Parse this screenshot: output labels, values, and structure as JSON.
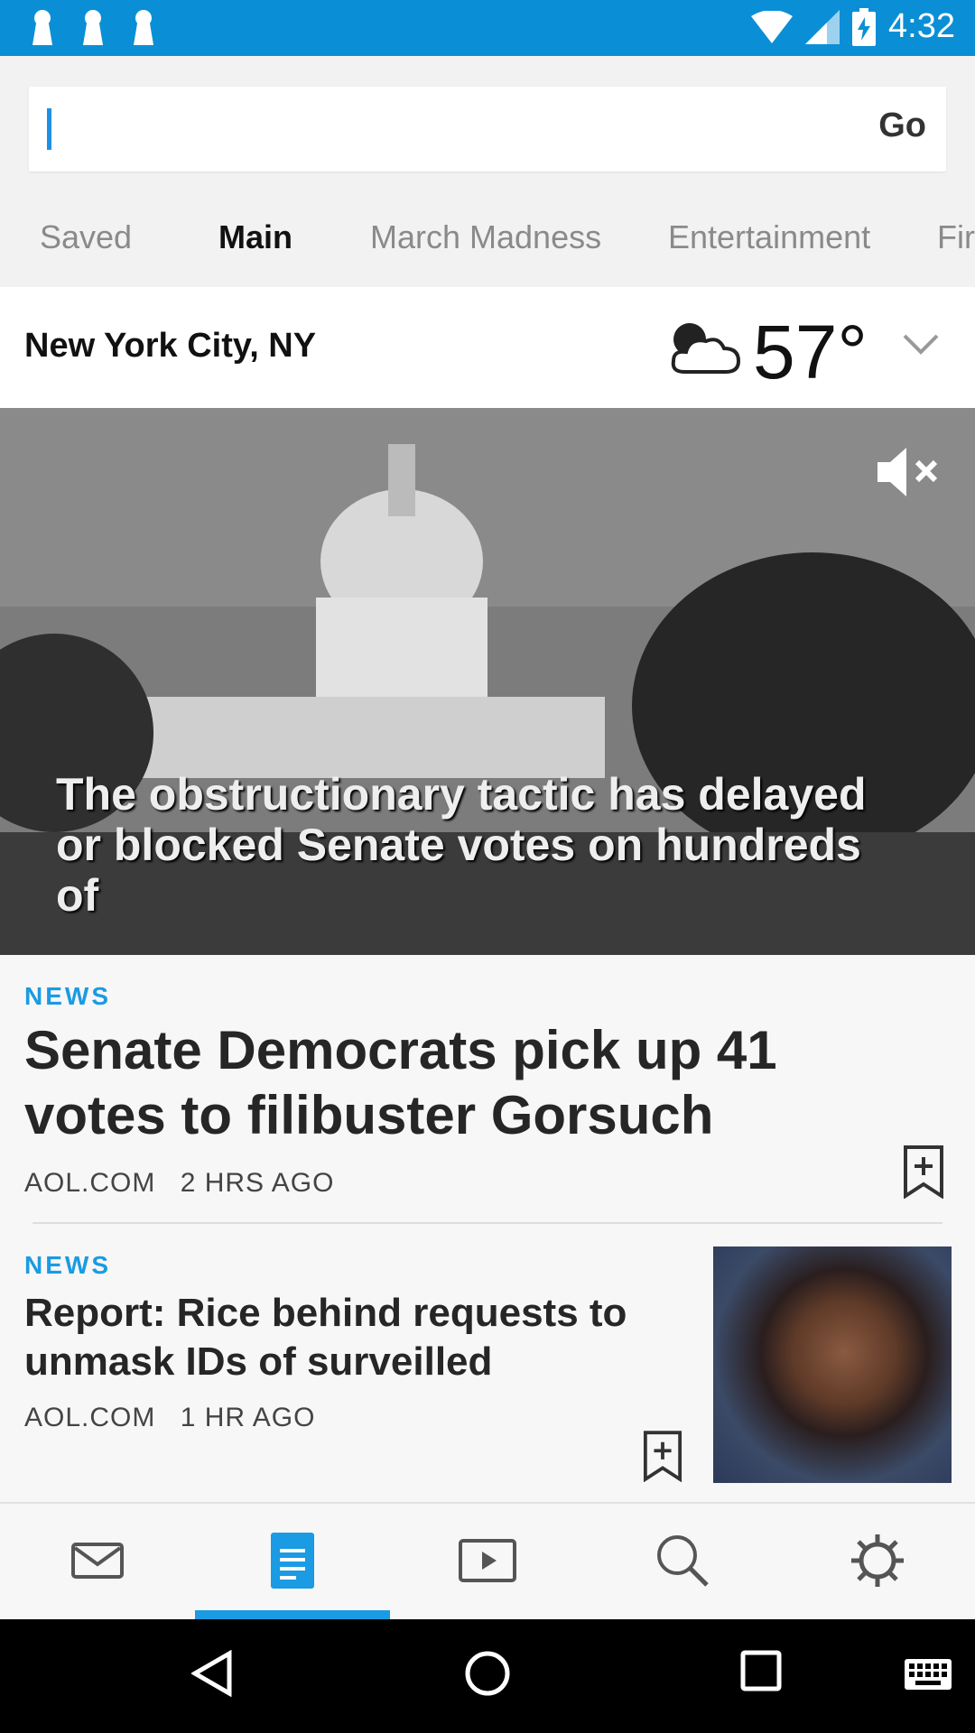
{
  "status_bar": {
    "time": "4:32"
  },
  "search": {
    "placeholder": "",
    "go_label": "Go"
  },
  "tabs": [
    {
      "label": "Saved"
    },
    {
      "label": "Main"
    },
    {
      "label": "March Madness"
    },
    {
      "label": "Entertainment"
    },
    {
      "label": "Fir"
    }
  ],
  "weather": {
    "city": "New York City, NY",
    "temperature": "57°",
    "condition_icon": "cloudy-icon"
  },
  "hero": {
    "caption": "The obstructionary tactic has delayed or blocked Senate votes on hundreds of"
  },
  "articles": [
    {
      "category": "NEWS",
      "title": "Senate Democrats pick up 41 votes to filibuster Gorsuch",
      "source": "AOL.COM",
      "time": "2 HRS AGO"
    },
    {
      "category": "NEWS",
      "title": "Report: Rice behind requests to unmask IDs of surveilled",
      "source": "AOL.COM",
      "time": "1 HR AGO"
    }
  ],
  "bottom_nav": [
    "mail-icon",
    "news-icon",
    "video-icon",
    "search-icon",
    "settings-icon"
  ],
  "colors": {
    "accent": "#1a9be3",
    "status_bar": "#0a8fd6"
  }
}
